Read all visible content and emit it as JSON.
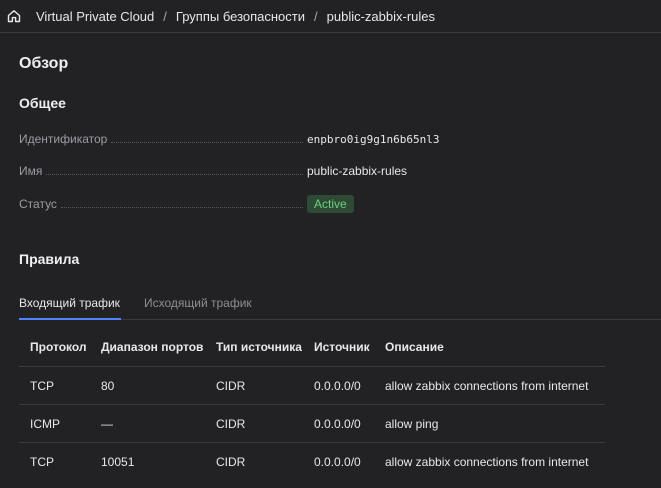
{
  "breadcrumb": {
    "home_icon": "home-icon",
    "items": [
      "Virtual Private Cloud",
      "Группы безопасности",
      "public-zabbix-rules"
    ],
    "separator": "/"
  },
  "overview": {
    "title": "Обзор",
    "general": {
      "title": "Общее",
      "fields": [
        {
          "key": "Идентификатор",
          "value": "enpbro0ig9g1n6b65nl3"
        },
        {
          "key": "Имя",
          "value": "public-zabbix-rules"
        },
        {
          "key": "Статус",
          "value": "Active"
        }
      ]
    }
  },
  "rules": {
    "title": "Правила",
    "tabs": [
      {
        "label": "Входящий трафик",
        "active": true
      },
      {
        "label": "Исходящий трафик",
        "active": false
      }
    ],
    "columns": [
      "Протокол",
      "Диапазон портов",
      "Тип источника",
      "Источник",
      "Описание"
    ],
    "rows": [
      [
        "TCP",
        "80",
        "CIDR",
        "0.0.0.0/0",
        "allow zabbix connections from internet"
      ],
      [
        "ICMP",
        "—",
        "CIDR",
        "0.0.0.0/0",
        "allow ping"
      ],
      [
        "TCP",
        "10051",
        "CIDR",
        "0.0.0.0/0",
        "allow zabbix connections from internet"
      ]
    ]
  },
  "colors": {
    "background": "#222225",
    "accent": "#5282ff",
    "status_active_bg": "#2e4a34",
    "status_active_text": "#6fce80"
  }
}
